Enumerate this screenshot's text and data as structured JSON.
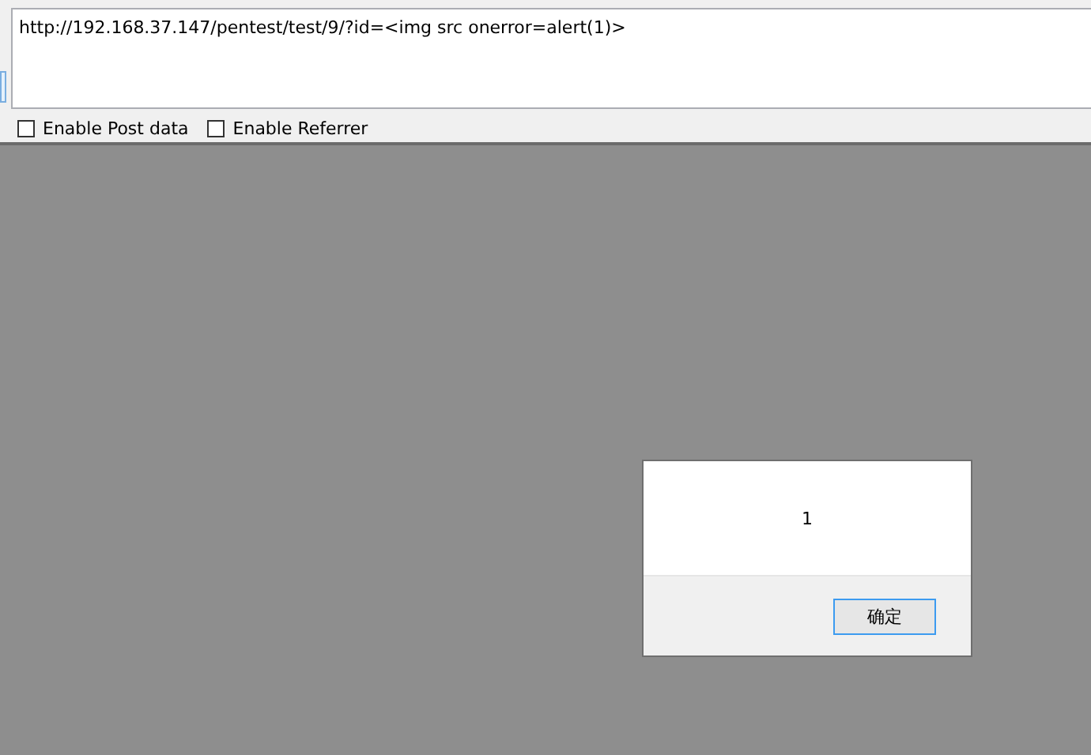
{
  "url_field": {
    "value": "http://192.168.37.147/pentest/test/9/?id=<img src onerror=alert(1)>"
  },
  "options": [
    {
      "label": "Enable Post data",
      "checked": false
    },
    {
      "label": "Enable Referrer",
      "checked": false
    }
  ],
  "alert_dialog": {
    "message": "1",
    "button": "确定"
  }
}
